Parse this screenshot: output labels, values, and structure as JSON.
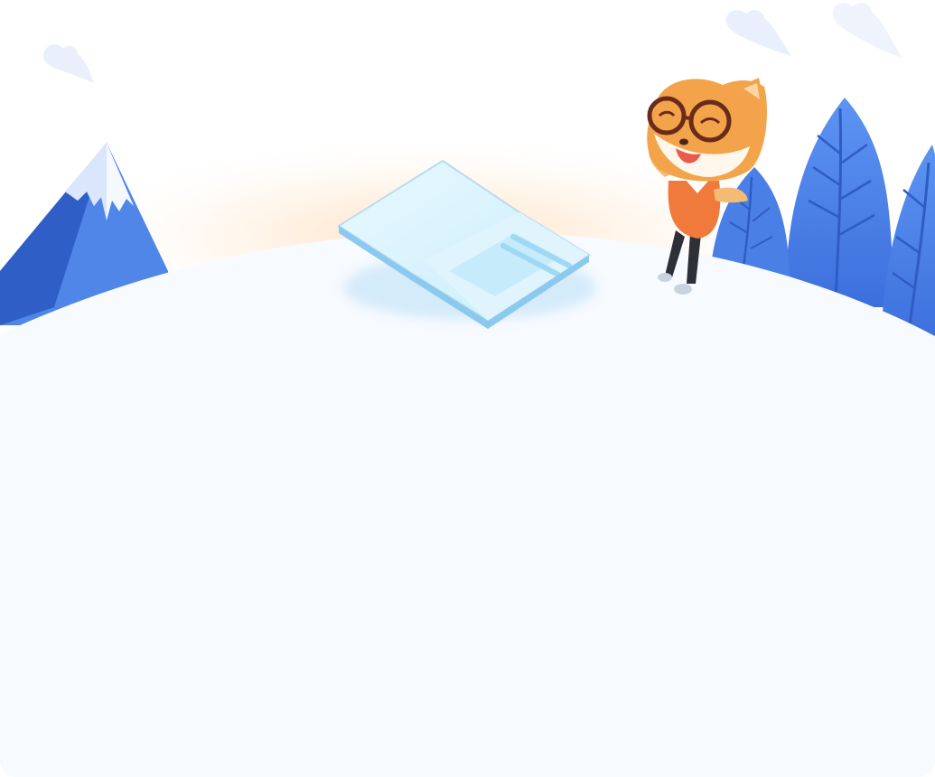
{
  "scene": {
    "colors": {
      "background": "#ffffff",
      "panel": "#f7faff",
      "mountain_dark": "#2f5fc6",
      "mountain_light": "#4f86e8",
      "tree_dark": "#3b6fde",
      "tree_light": "#5b92f0",
      "fox_orange": "#f2a24a",
      "shirt": "#f07a3c",
      "book": "#bfe6f7",
      "glow": "#ffe2c4"
    },
    "icons": {
      "mountain": "mountain-icon",
      "fox": "fox-mascot-icon",
      "book": "open-book-icon",
      "trees": "tree-icon",
      "cloud": "cloud-icon"
    }
  }
}
